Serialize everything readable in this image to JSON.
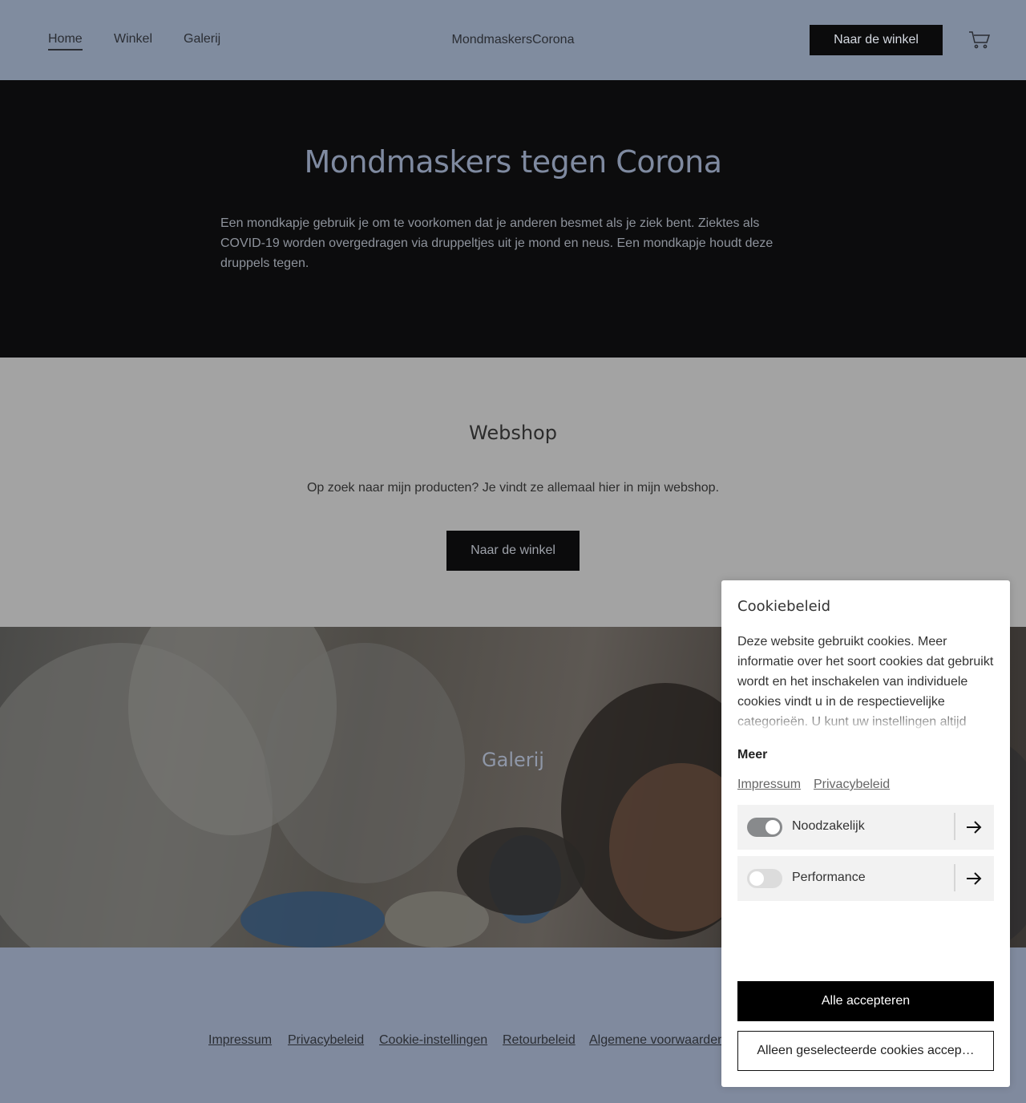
{
  "header": {
    "nav": [
      "Home",
      "Winkel",
      "Galerij"
    ],
    "brand": "MondmaskersCorona",
    "shop_button": "Naar de winkel",
    "cart_icon": "cart-icon"
  },
  "hero": {
    "title": "Mondmaskers tegen Corona",
    "text": "Een mondkapje gebruik je om te voorkomen dat je anderen besmet als je ziek bent. Ziektes als COVID-19 worden overgedragen via druppeltjes uit je mond en neus. Een mondkapje houdt deze druppels tegen."
  },
  "webshop": {
    "title": "Webshop",
    "text": "Op zoek naar mijn producten? Je vindt ze allemaal hier in mijn webshop.",
    "button": "Naar de winkel"
  },
  "gallery": {
    "title": "Galerij"
  },
  "footer": {
    "links": [
      "Impressum",
      "Privacybeleid",
      "Cookie-instellingen",
      "Retourbeleid",
      "Algemene voorwaarden"
    ]
  },
  "cookie": {
    "title": "Cookiebeleid",
    "description": "Deze website gebruikt cookies. Meer informatie over het soort cookies dat gebruikt wordt en het inschakelen van individuele cookies vindt u in de respectievelijke categorieën. U kunt uw instellingen altijd",
    "more": "Meer",
    "links": [
      "Impressum",
      "Privacybeleid"
    ],
    "categories": [
      {
        "label": "Noodzakelijk",
        "enabled": true
      },
      {
        "label": "Performance",
        "enabled": false
      }
    ],
    "accept_all": "Alle accepteren",
    "accept_selected": "Alleen geselecteerde cookies accep…"
  }
}
